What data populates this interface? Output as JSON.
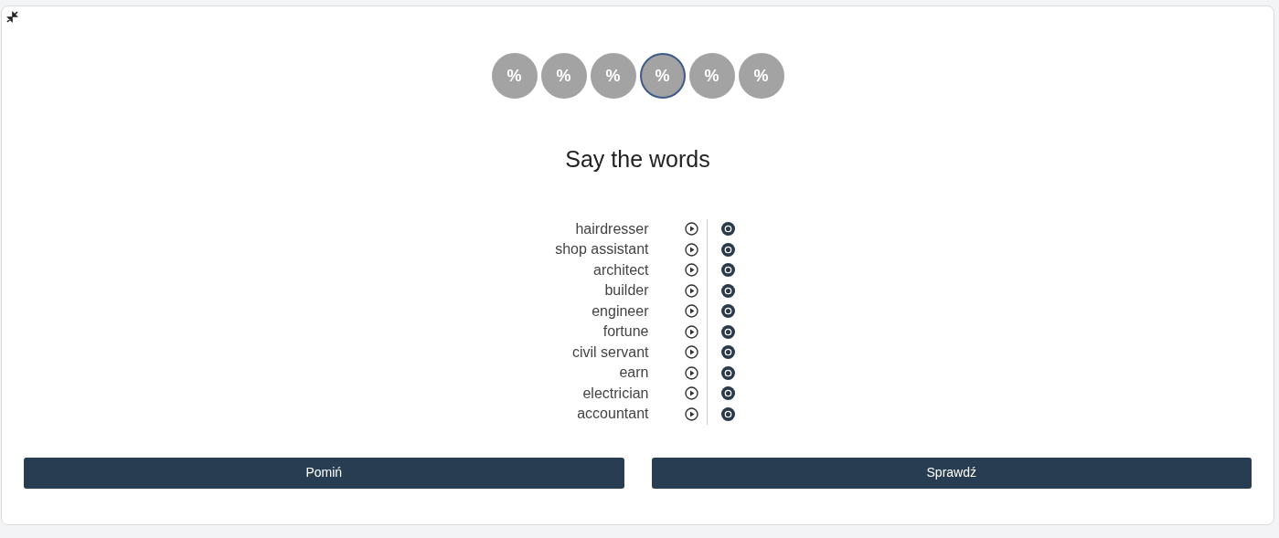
{
  "steps": [
    {
      "label": "%",
      "selected": false
    },
    {
      "label": "%",
      "selected": false
    },
    {
      "label": "%",
      "selected": false
    },
    {
      "label": "%",
      "selected": true
    },
    {
      "label": "%",
      "selected": false
    },
    {
      "label": "%",
      "selected": false
    }
  ],
  "title": "Say the words",
  "words": [
    "hairdresser",
    "shop assistant",
    "architect",
    "builder",
    "engineer",
    "fortune",
    "civil servant",
    "earn",
    "electrician",
    "accountant"
  ],
  "buttons": [
    "Pomiń",
    "Sprawdź"
  ]
}
